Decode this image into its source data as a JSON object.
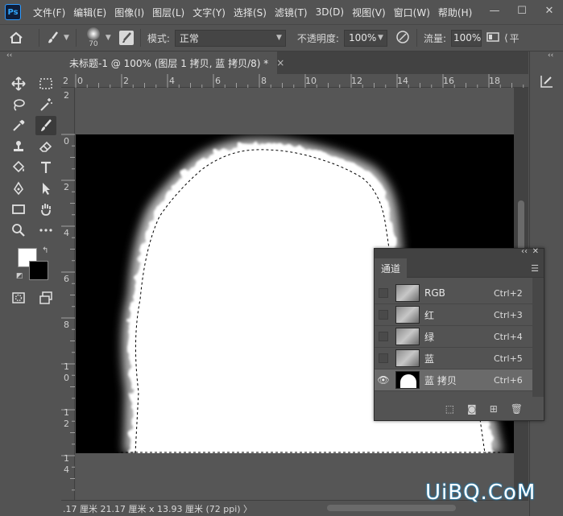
{
  "app": {
    "logo": "Ps"
  },
  "menu": [
    "文件(F)",
    "编辑(E)",
    "图像(I)",
    "图层(L)",
    "文字(Y)",
    "选择(S)",
    "滤镜(T)",
    "3D(D)",
    "视图(V)",
    "窗口(W)",
    "帮助(H)"
  ],
  "window_controls": {
    "minimize": "—",
    "maximize": "☐",
    "close": "✕"
  },
  "options": {
    "brush_size": "70",
    "mode_label": "模式:",
    "mode_value": "正常",
    "opacity_label": "不透明度:",
    "opacity_value": "100%",
    "flow_label": "流量:",
    "flow_value": "100%",
    "trailing": "平"
  },
  "document": {
    "tab_title": "未标题-1 @ 100% (图层 1 拷贝, 蓝 拷贝/8) *",
    "close": "×"
  },
  "rulers": {
    "horizontal": [
      "2",
      "0",
      "2",
      "4",
      "6",
      "8",
      "10",
      "12",
      "14",
      "16",
      "18"
    ],
    "vertical": [
      "2",
      "0",
      "2",
      "4",
      "6",
      "8",
      "1",
      "0",
      "1",
      "2",
      "1",
      "4"
    ]
  },
  "channels_panel": {
    "collapse": "‹‹",
    "close": "✕",
    "tab": "通道",
    "channels": [
      {
        "name": "RGB",
        "shortcut": "Ctrl+2",
        "visible": false,
        "selected": false
      },
      {
        "name": "红",
        "shortcut": "Ctrl+3",
        "visible": false,
        "selected": false
      },
      {
        "name": "绿",
        "shortcut": "Ctrl+4",
        "visible": false,
        "selected": false
      },
      {
        "name": "蓝",
        "shortcut": "Ctrl+5",
        "visible": false,
        "selected": false
      },
      {
        "name": "蓝 拷贝",
        "shortcut": "Ctrl+6",
        "visible": true,
        "selected": true
      }
    ]
  },
  "status": {
    "text": ".17 厘米  21.17 厘米 x 13.93 厘米 (72 ppi)  〉"
  },
  "watermark": "UiBQ.CoM"
}
